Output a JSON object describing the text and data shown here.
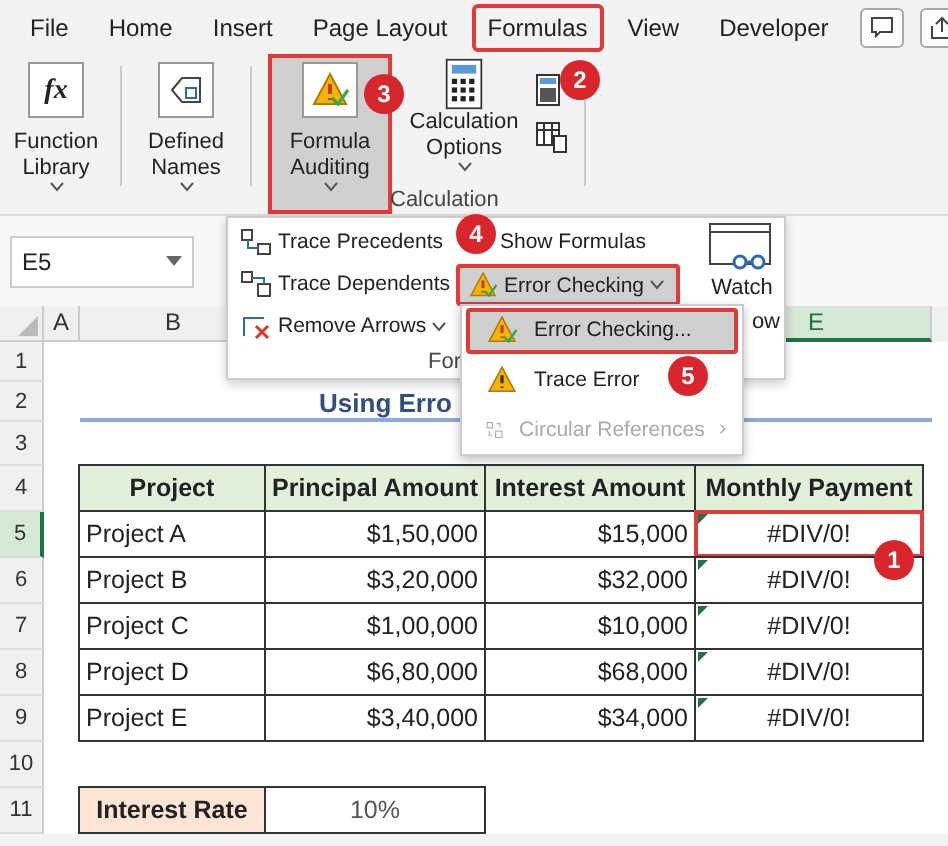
{
  "ribbon_tabs": [
    {
      "label": "File",
      "selected": false
    },
    {
      "label": "Home",
      "selected": false
    },
    {
      "label": "Insert",
      "selected": false
    },
    {
      "label": "Page Layout",
      "selected": false
    },
    {
      "label": "Formulas",
      "selected": true
    },
    {
      "label": "View",
      "selected": false
    },
    {
      "label": "Developer",
      "selected": false
    }
  ],
  "ribbon_buttons": [
    {
      "kind": "fx",
      "label": "Function Library",
      "selected": false
    },
    {
      "kind": "names",
      "label": "Defined Names",
      "selected": false
    },
    {
      "kind": "auditing",
      "label": "Formula Auditing",
      "selected": true
    },
    {
      "kind": "calc",
      "label": "Calculation Options",
      "selected": false
    }
  ],
  "calculation_group": "Calculation",
  "name_box": "E5",
  "column_headers": [
    "A",
    "B",
    "E"
  ],
  "row_headers": [
    "1",
    "2",
    "3",
    "4",
    "5",
    "6",
    "7",
    "8",
    "9",
    "10",
    "11"
  ],
  "sheet_title": "Using Erro",
  "table": {
    "columns": [
      "Project",
      "Principal Amount",
      "Interest Amount",
      "Monthly Payment"
    ],
    "rows": [
      {
        "cells": [
          "Project A",
          "$1,50,000",
          "$15,000",
          "#DIV/0!"
        ],
        "selected": true,
        "error_indicator": true
      },
      {
        "cells": [
          "Project B",
          "$3,20,000",
          "$32,000",
          "#DIV/0!"
        ],
        "selected": false,
        "error_indicator": true
      },
      {
        "cells": [
          "Project C",
          "$1,00,000",
          "$10,000",
          "#DIV/0!"
        ],
        "selected": false,
        "error_indicator": true
      },
      {
        "cells": [
          "Project D",
          "$6,80,000",
          "$68,000",
          "#DIV/0!"
        ],
        "selected": false,
        "error_indicator": true
      },
      {
        "cells": [
          "Project E",
          "$3,40,000",
          "$34,000",
          "#DIV/0!"
        ],
        "selected": false,
        "error_indicator": true
      }
    ]
  },
  "interest_rate": {
    "label": "Interest Rate",
    "value": "10%"
  },
  "auditing_menu": {
    "items": [
      {
        "kind": "precedents",
        "label": "Trace Precedents"
      },
      {
        "kind": "dependents",
        "label": "Trace Dependents"
      },
      {
        "kind": "remove",
        "label": "Remove Arrows"
      }
    ],
    "show_formulas": "Show Formulas",
    "error_checking": {
      "label": "Error Checking",
      "selected": true
    },
    "watch_label": "Watch",
    "watch_label_cut": "ow",
    "group_label": "For"
  },
  "submenu": [
    {
      "kind": "check",
      "label": "Error Checking...",
      "selected": true,
      "disabled": false
    },
    {
      "kind": "trace",
      "label": "Trace Error",
      "selected": false,
      "disabled": false
    },
    {
      "kind": "circular",
      "label": "Circular References",
      "selected": false,
      "disabled": true
    }
  ],
  "callouts": [
    "1",
    "2",
    "3",
    "4",
    "5"
  ]
}
